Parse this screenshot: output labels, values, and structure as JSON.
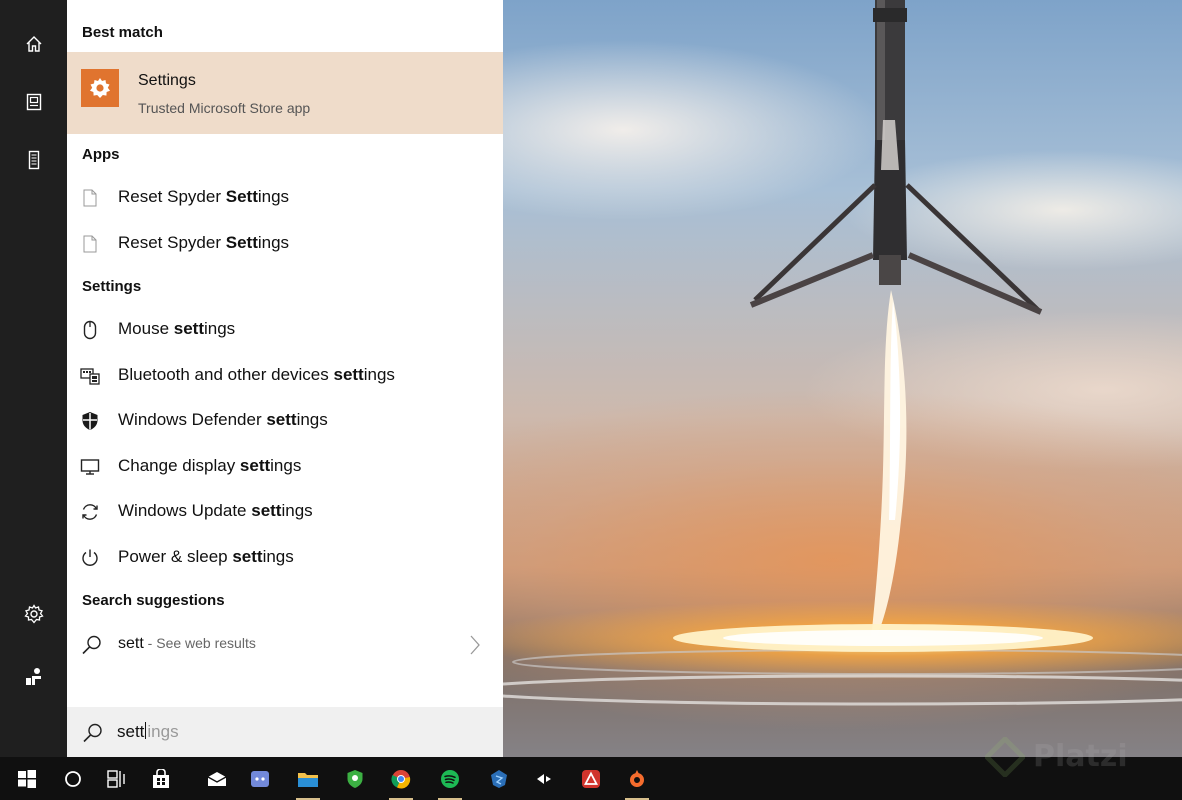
{
  "colors": {
    "rail_bg": "#1f1f1f",
    "best_match_bg": "#efdcca",
    "settings_tile": "#e0742f",
    "searchbox_bg": "#f0f0f0",
    "taskbar_bg": "#101010"
  },
  "rail": {
    "items": [
      {
        "name": "home",
        "icon": "home-icon"
      },
      {
        "name": "documents",
        "icon": "document-icon"
      },
      {
        "name": "device",
        "icon": "device-icon"
      },
      {
        "name": "settings",
        "icon": "gear-icon"
      },
      {
        "name": "feedback",
        "icon": "feedback-icon"
      }
    ]
  },
  "best_match": {
    "header": "Best match",
    "title": "Settings",
    "subtitle": "Trusted Microsoft Store app",
    "icon": "gear-icon"
  },
  "apps": {
    "header": "Apps",
    "items": [
      {
        "prefix": "Reset Spyder ",
        "bold": "Sett",
        "suffix": "ings",
        "icon": "file-icon"
      },
      {
        "prefix": "Reset Spyder ",
        "bold": "Sett",
        "suffix": "ings",
        "icon": "file-icon"
      }
    ]
  },
  "settings_group": {
    "header": "Settings",
    "items": [
      {
        "prefix": "Mouse ",
        "bold": "sett",
        "suffix": "ings",
        "icon": "mouse-icon"
      },
      {
        "prefix": "Bluetooth and other devices ",
        "bold": "sett",
        "suffix": "ings",
        "icon": "keyboard-devices-icon"
      },
      {
        "prefix": "Windows Defender ",
        "bold": "sett",
        "suffix": "ings",
        "icon": "shield-icon"
      },
      {
        "prefix": "Change display ",
        "bold": "sett",
        "suffix": "ings",
        "icon": "monitor-icon"
      },
      {
        "prefix": "Windows Update ",
        "bold": "sett",
        "suffix": "ings",
        "icon": "refresh-icon"
      },
      {
        "prefix": "Power & sleep ",
        "bold": "sett",
        "suffix": "ings",
        "icon": "power-icon"
      }
    ]
  },
  "suggestions": {
    "header": "Search suggestions",
    "query": "sett",
    "hint": " - See web results"
  },
  "search": {
    "typed": "sett",
    "ghost": "ings"
  },
  "taskbar": {
    "items": [
      {
        "name": "start",
        "icon": "windows-logo-icon"
      },
      {
        "name": "cortana",
        "icon": "cortana-circle-icon"
      },
      {
        "name": "task-view",
        "icon": "task-view-icon"
      },
      {
        "name": "store",
        "icon": "store-bag-icon"
      },
      {
        "name": "mail",
        "icon": "mail-icon"
      },
      {
        "name": "discord",
        "icon": "discord-icon"
      },
      {
        "name": "file-explorer",
        "icon": "folder-icon",
        "active": true
      },
      {
        "name": "security",
        "icon": "shield-app-icon"
      },
      {
        "name": "chrome",
        "icon": "chrome-icon",
        "active": true
      },
      {
        "name": "spotify",
        "icon": "spotify-icon",
        "active": true
      },
      {
        "name": "app-blue",
        "icon": "blue-app-icon"
      },
      {
        "name": "media",
        "icon": "media-icon"
      },
      {
        "name": "adobe",
        "icon": "red-triangle-app-icon"
      },
      {
        "name": "origin",
        "icon": "orange-app-icon",
        "active": true
      }
    ]
  },
  "watermark": "Platzi"
}
